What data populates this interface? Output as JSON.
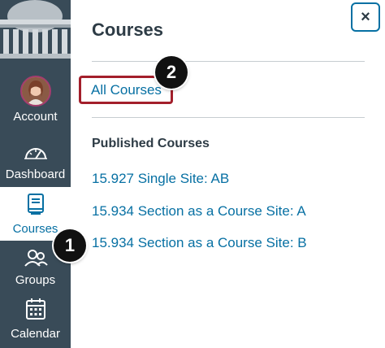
{
  "sidebar": {
    "items": [
      {
        "label": "Account",
        "icon": "avatar"
      },
      {
        "label": "Dashboard",
        "icon": "speedometer-icon"
      },
      {
        "label": "Courses",
        "icon": "book-icon",
        "active": true
      },
      {
        "label": "Groups",
        "icon": "people-icon"
      },
      {
        "label": "Calendar",
        "icon": "calendar-icon"
      }
    ]
  },
  "tray": {
    "title": "Courses",
    "close_label": "×",
    "all_courses_label": "All Courses",
    "published_heading": "Published Courses",
    "courses": [
      "15.927 Single Site: AB",
      "15.934 Section as a Course Site: A",
      "15.934 Section as a Course Site: B"
    ]
  },
  "callouts": [
    "1",
    "2"
  ],
  "colors": {
    "sidebar_bg": "#394b58",
    "link": "#0770a3",
    "highlight_box": "#a31f2b",
    "avatar_ring": "#a53c6e"
  }
}
